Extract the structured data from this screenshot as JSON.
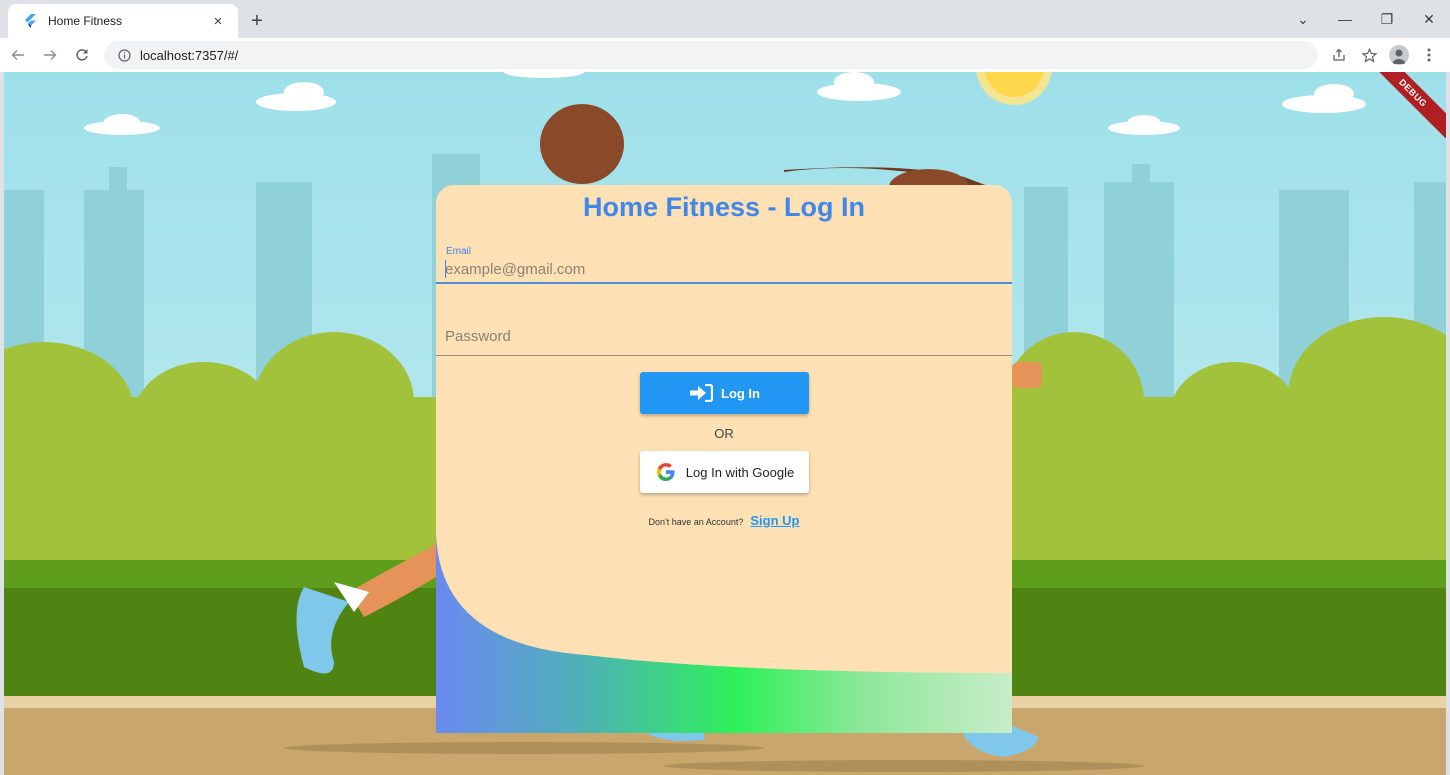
{
  "browser": {
    "tab_title": "Home Fitness",
    "tab_close": "×",
    "new_tab": "+",
    "url": "localhost:7357/#/",
    "window_min": "—",
    "window_restore": "❐",
    "window_close": "✕",
    "tab_search": "⌄"
  },
  "page": {
    "debug_banner": "DEBUG",
    "title": "Home Fitness - Log In",
    "email": {
      "label": "Email",
      "placeholder": "example@gmail.com",
      "value": ""
    },
    "password": {
      "placeholder": "Password",
      "value": ""
    },
    "login_button": "Log In",
    "or_text": "OR",
    "google_button": "Log In with Google",
    "signup_question": "Don't have an Account?",
    "signup_link": "Sign Up"
  },
  "colors": {
    "accent": "#2196f3",
    "title": "#3f87e8",
    "card": "#fde0b3",
    "debug": "#b01f24"
  },
  "icons": {
    "tab_favicon": "flutter-icon",
    "login_icon": "login-arrow-icon",
    "google_icon": "google-g-icon"
  }
}
